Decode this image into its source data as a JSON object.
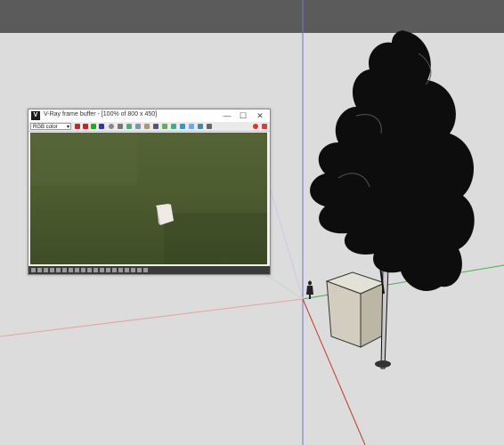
{
  "window": {
    "title": "V-Ray frame buffer - [100% of 800 x 450]",
    "logo_text": "V",
    "min_symbol": "—",
    "max_symbol": "☐",
    "close_symbol": "✕"
  },
  "toolbar": {
    "channel_value": "RGB color",
    "channel_arrow": "▾"
  },
  "colors": {
    "top_bar": "#5b5b5b",
    "viewport_bg": "#dcdcdc",
    "grass": "#4b5b30",
    "axis_red": "#c0392b",
    "axis_green": "#4caf50",
    "axis_blue": "#3f51b5"
  },
  "icons": [
    "logo-icon",
    "minimize-icon",
    "maximize-icon",
    "close-icon",
    "render-icon",
    "stop-icon"
  ]
}
